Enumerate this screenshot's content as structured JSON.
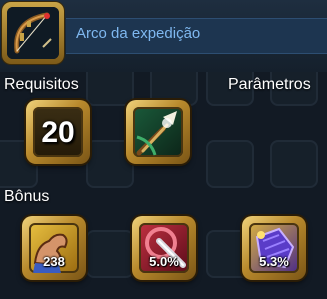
{
  "item": {
    "name": "Arco da expedição",
    "icon": "bow-icon"
  },
  "requirements": {
    "label": "Requisitos",
    "level": "20"
  },
  "parameters": {
    "label": "Parâmetros",
    "icon": "expedition-arrow-icon"
  },
  "bonus": {
    "label": "Bônus",
    "items": [
      {
        "icon": "strength-arm-icon",
        "value": "238"
      },
      {
        "icon": "critical-damage-icon",
        "value": "5.0%"
      },
      {
        "icon": "armor-penetration-icon",
        "value": "5.3%"
      }
    ]
  },
  "colors": {
    "accent_blue": "#7fb8f0",
    "gold_frame": "#c9a447",
    "background": "#16202a"
  }
}
